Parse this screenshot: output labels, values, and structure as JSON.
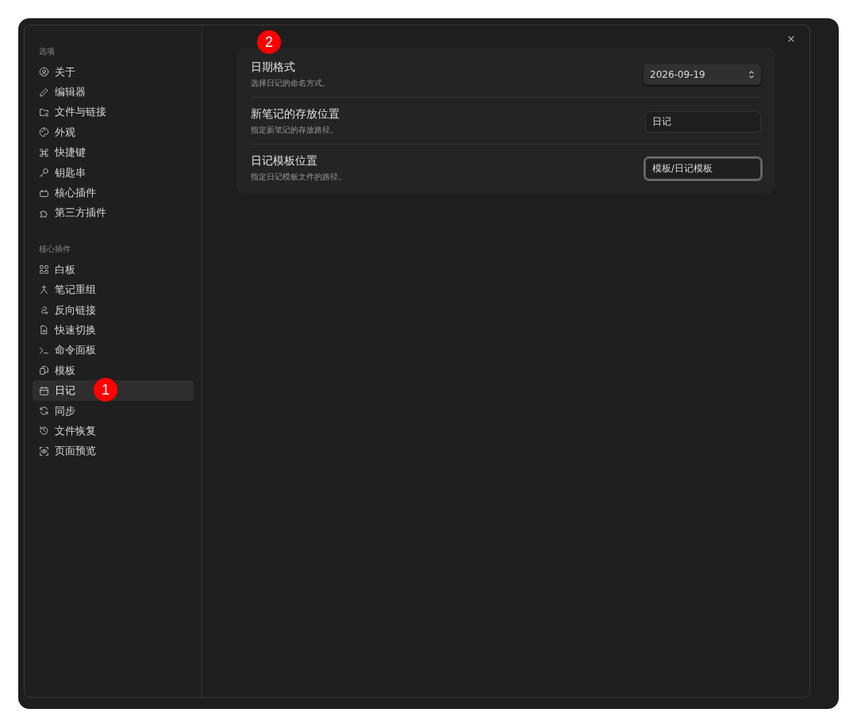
{
  "sidebar": {
    "sections": [
      {
        "heading": "选项",
        "items": [
          {
            "label": "关于",
            "selected": false
          },
          {
            "label": "编辑器",
            "selected": false
          },
          {
            "label": "文件与链接",
            "selected": false
          },
          {
            "label": "外观",
            "selected": false
          },
          {
            "label": "快捷键",
            "selected": false
          },
          {
            "label": "钥匙串",
            "selected": false
          },
          {
            "label": "核心插件",
            "selected": false
          },
          {
            "label": "第三方插件",
            "selected": false
          }
        ]
      },
      {
        "heading": "核心插件",
        "items": [
          {
            "label": "白板",
            "selected": false
          },
          {
            "label": "笔记重组",
            "selected": false
          },
          {
            "label": "反向链接",
            "selected": false
          },
          {
            "label": "快速切换",
            "selected": false
          },
          {
            "label": "命令面板",
            "selected": false
          },
          {
            "label": "模板",
            "selected": false
          },
          {
            "label": "日记",
            "selected": true
          },
          {
            "label": "同步",
            "selected": false
          },
          {
            "label": "文件恢复",
            "selected": false
          },
          {
            "label": "页面预览",
            "selected": false
          }
        ]
      }
    ]
  },
  "settings": [
    {
      "name": "日期格式",
      "description": "选择日记的命名方式。",
      "kind": "select",
      "value": "2026-09-19",
      "focused": false
    },
    {
      "name": "新笔记的存放位置",
      "description": "指定新笔记的存放路径。",
      "kind": "text",
      "value": "日记",
      "focused": false
    },
    {
      "name": "日记模板位置",
      "description": "指定日记模板文件的路径。",
      "kind": "text",
      "value": "模板/日记模板",
      "focused": true
    }
  ],
  "annotations": [
    "1",
    "2"
  ]
}
